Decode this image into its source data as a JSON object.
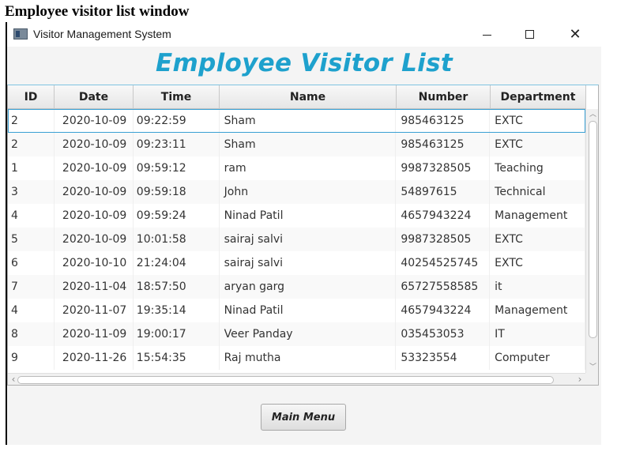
{
  "caption": "Employee visitor list window",
  "window": {
    "title": "Visitor Management System",
    "minimize_icon": "minimize-icon",
    "maximize_icon": "maximize-icon",
    "close_glyph": "✕",
    "close_icon": "close-icon"
  },
  "heading": "Employee Visitor List",
  "colors": {
    "accent": "#1ea1cd",
    "selection": "#39a0d3"
  },
  "table": {
    "columns": [
      "ID",
      "Date",
      "Time",
      "Name",
      "Number",
      "Department"
    ],
    "rows": [
      [
        "2",
        "2020-10-09",
        "09:22:59",
        "Sham",
        "985463125",
        "EXTC"
      ],
      [
        "2",
        "2020-10-09",
        "09:23:11",
        "Sham",
        "985463125",
        "EXTC"
      ],
      [
        "1",
        "2020-10-09",
        "09:59:12",
        "ram",
        "9987328505",
        "Teaching"
      ],
      [
        "3",
        "2020-10-09",
        "09:59:18",
        "John",
        "54897615",
        "Technical"
      ],
      [
        "4",
        "2020-10-09",
        "09:59:24",
        "Ninad Patil",
        "4657943224",
        "Management"
      ],
      [
        "5",
        "2020-10-09",
        "10:01:58",
        "sairaj salvi",
        "9987328505",
        "EXTC"
      ],
      [
        "6",
        "2020-10-10",
        "21:24:04",
        "sairaj salvi",
        "40254525745",
        "EXTC"
      ],
      [
        "7",
        "2020-11-04",
        "18:57:50",
        "aryan garg",
        "65727558585",
        "it"
      ],
      [
        "4",
        "2020-11-07",
        "19:35:14",
        "Ninad Patil",
        "4657943224",
        "Management"
      ],
      [
        "8",
        "2020-11-09",
        "19:00:17",
        "Veer Panday",
        "035453053",
        "IT"
      ],
      [
        "9",
        "2020-11-26",
        "15:54:35",
        "Raj mutha",
        "53323554",
        "Computer"
      ]
    ],
    "selected_row": 0
  },
  "scroll": {
    "up": "︿",
    "down": "﹀",
    "left": "‹",
    "right": "›"
  },
  "main_menu_label": "Main Menu"
}
